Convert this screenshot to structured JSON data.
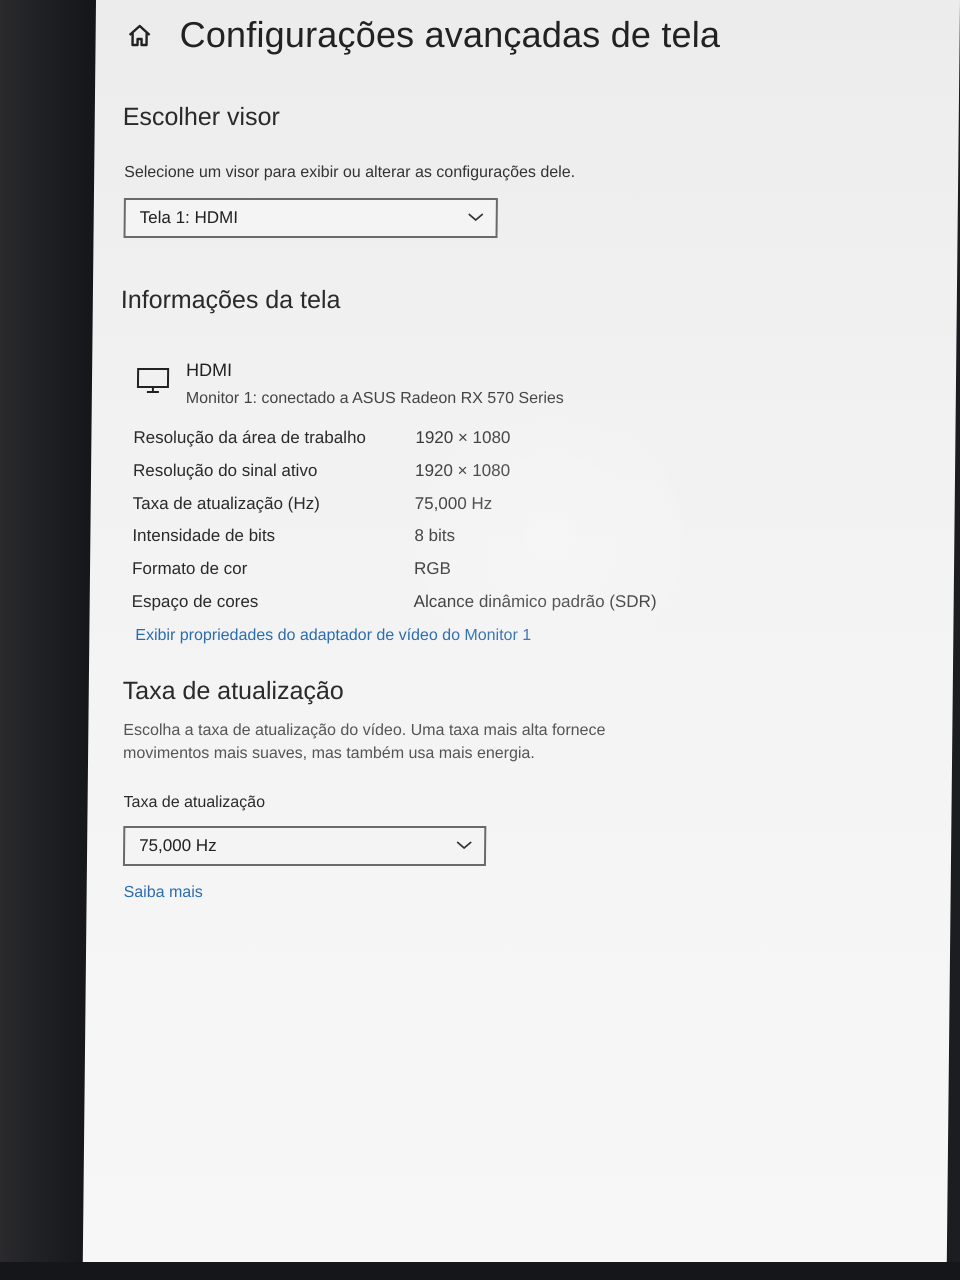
{
  "page": {
    "title": "Configurações avançadas de tela"
  },
  "choose_display": {
    "heading": "Escolher visor",
    "description": "Selecione um visor para exibir ou alterar as configurações dele.",
    "selected": "Tela 1: HDMI"
  },
  "display_info": {
    "heading": "Informações da tela",
    "monitor_name": "HDMI",
    "monitor_detail": "Monitor 1: conectado a ASUS Radeon RX 570 Series",
    "rows": [
      {
        "label": "Resolução da área de trabalho",
        "value": "1920 × 1080"
      },
      {
        "label": "Resolução do sinal ativo",
        "value": "1920 × 1080"
      },
      {
        "label": "Taxa de atualização (Hz)",
        "value": "75,000 Hz"
      },
      {
        "label": "Intensidade de bits",
        "value": "8 bits"
      },
      {
        "label": "Formato de cor",
        "value": "RGB"
      },
      {
        "label": "Espaço de cores",
        "value": "Alcance dinâmico padrão (SDR)"
      }
    ],
    "adapter_link": "Exibir propriedades do adaptador de vídeo do Monitor 1"
  },
  "refresh_rate": {
    "heading": "Taxa de atualização",
    "description_line1": "Escolha a taxa de atualização do vídeo. Uma taxa mais alta fornece",
    "description_line2": "movimentos mais suaves, mas também usa mais energia.",
    "field_label": "Taxa de atualização",
    "selected": "75,000 Hz",
    "learn_more": "Saiba mais"
  },
  "colors": {
    "link": "#2b6cb0",
    "background": "#f2f2f2",
    "text": "#1f1f1f"
  },
  "icons": {
    "home": "home-icon",
    "monitor": "monitor-icon",
    "chevron": "chevron-down-icon"
  }
}
